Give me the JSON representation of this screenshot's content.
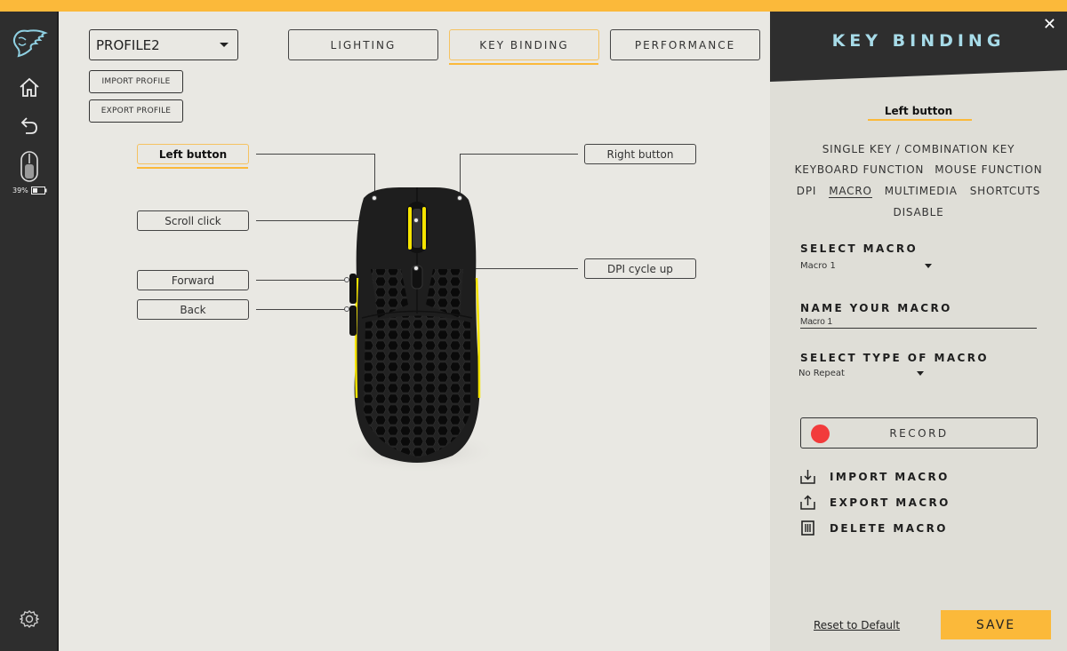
{
  "colors": {
    "accent": "#fbb93a",
    "sidebar": "#2e2e2e",
    "panel_title": "#a7dbe8",
    "record": "#f23b3b"
  },
  "sidebar": {
    "items": [
      {
        "name": "logo",
        "icon": "lion-logo-icon"
      },
      {
        "name": "home",
        "icon": "home-icon"
      },
      {
        "name": "back",
        "icon": "back-arrow-icon"
      },
      {
        "name": "device",
        "icon": "mouse-device-icon"
      },
      {
        "name": "settings",
        "icon": "gear-icon"
      }
    ],
    "battery": {
      "percent_text": "39%",
      "level": 0.39
    }
  },
  "main": {
    "profile_select": {
      "value": "PROFILE2"
    },
    "import_profile_label": "IMPORT PROFILE",
    "export_profile_label": "EXPORT PROFILE",
    "tabs": [
      {
        "label": "LIGHTING",
        "active": false
      },
      {
        "label": "KEY BINDING",
        "active": true
      },
      {
        "label": "PERFORMANCE",
        "active": false
      }
    ],
    "buttons": {
      "left": "Left button",
      "right": "Right button",
      "scroll": "Scroll click",
      "dpi": "DPI cycle up",
      "forward": "Forward",
      "back": "Back"
    }
  },
  "panel": {
    "title": "KEY BINDING",
    "close_icon": "close-icon",
    "selected_button": "Left button",
    "functions": {
      "row1": [
        "SINGLE KEY / COMBINATION KEY"
      ],
      "row2": [
        "KEYBOARD FUNCTION",
        "MOUSE FUNCTION"
      ],
      "row3": [
        "DPI",
        "MACRO",
        "MULTIMEDIA",
        "SHORTCUTS"
      ],
      "row4": [
        "DISABLE"
      ],
      "active": "MACRO"
    },
    "select_macro_label": "SELECT MACRO",
    "select_macro_value": "Macro 1",
    "name_macro_label": "NAME YOUR MACRO",
    "name_macro_value": "Macro 1",
    "macro_type_label": "SELECT TYPE OF MACRO",
    "macro_type_value": "No Repeat",
    "record_label": "RECORD",
    "import_macro": "IMPORT MACRO",
    "export_macro": "EXPORT MACRO",
    "delete_macro": "DELETE MACRO",
    "reset_label": "Reset to Default",
    "save_label": "SAVE"
  }
}
